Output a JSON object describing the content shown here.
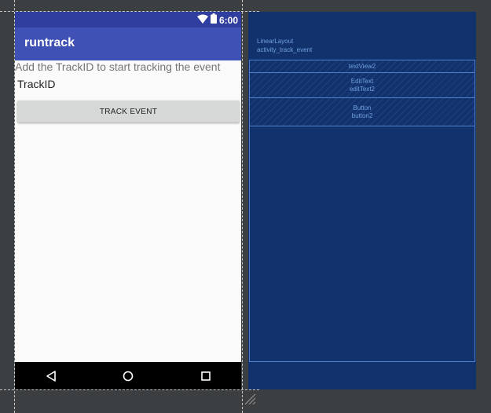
{
  "phone": {
    "status_time": "6:00",
    "app_title": "runtrack",
    "text_view": "Add the TrackID to start tracking the event",
    "edit_text": "TrackID",
    "button_label": "TRACK EVENT"
  },
  "blueprint": {
    "layout_type": "LinearLayout",
    "layout_id": "activity_track_event",
    "text_view_id": "textView2",
    "edit_text_type": "EditText",
    "edit_text_id": "editText2",
    "button_type": "Button",
    "button_id": "button2"
  },
  "colors": {
    "status_bar": "#303f9f",
    "app_bar": "#3f51b5",
    "blueprint_bg": "#12326d",
    "blueprint_line": "#4f7fc9"
  },
  "icons": [
    "wifi-icon",
    "battery-icon",
    "back-icon",
    "home-icon",
    "recents-icon"
  ]
}
